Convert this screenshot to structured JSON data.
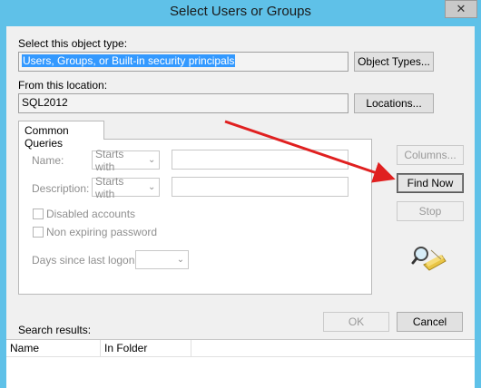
{
  "window": {
    "title": "Select Users or Groups",
    "close_glyph": "✕"
  },
  "object_type": {
    "label": "Select this object type:",
    "value": "Users, Groups, or Built-in security principals",
    "button": "Object Types..."
  },
  "location": {
    "label": "From this location:",
    "value": "SQL2012",
    "button": "Locations..."
  },
  "tab": {
    "label": "Common Queries"
  },
  "queries": {
    "name_label": "Name:",
    "name_mode": "Starts with",
    "description_label": "Description:",
    "description_mode": "Starts with",
    "disabled_accounts": "Disabled accounts",
    "non_expiring": "Non expiring password",
    "days_label": "Days since last logon:"
  },
  "side_buttons": {
    "columns": "Columns...",
    "find_now": "Find Now",
    "stop": "Stop"
  },
  "footer": {
    "ok": "OK",
    "cancel": "Cancel"
  },
  "results": {
    "label": "Search results:",
    "columns": [
      "Name",
      "In Folder"
    ]
  },
  "annotation": {
    "color": "#e02020"
  }
}
